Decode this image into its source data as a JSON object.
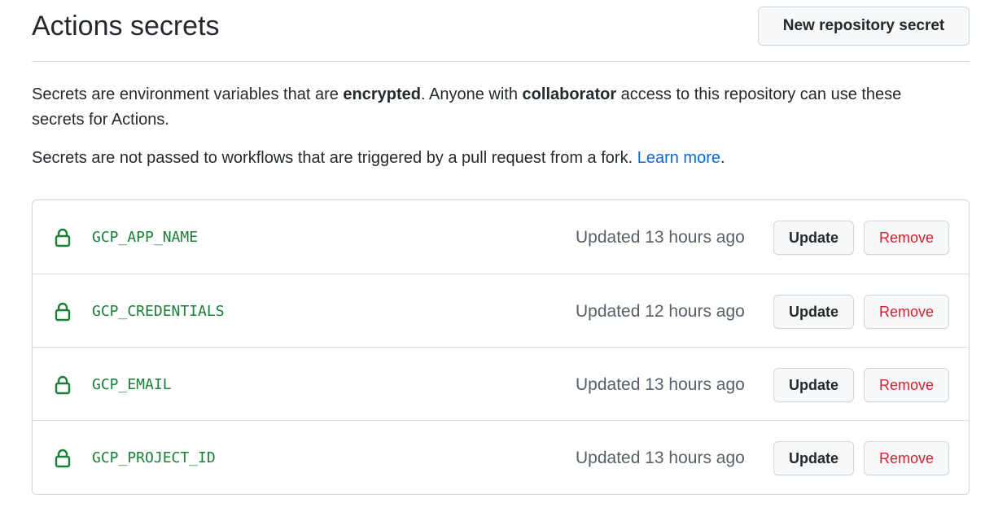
{
  "header": {
    "title": "Actions secrets",
    "new_secret_label": "New repository secret"
  },
  "description": {
    "line1_part1": "Secrets are environment variables that are ",
    "line1_bold1": "encrypted",
    "line1_part2": ". Anyone with ",
    "line1_bold2": "collaborator",
    "line1_part3": " access to this repository can use these secrets for Actions.",
    "line2_text": "Secrets are not passed to workflows that are triggered by a pull request from a fork. ",
    "line2_link": "Learn more",
    "line2_end": "."
  },
  "secrets": [
    {
      "name": "GCP_APP_NAME",
      "updated": "Updated 13 hours ago",
      "update_label": "Update",
      "remove_label": "Remove"
    },
    {
      "name": "GCP_CREDENTIALS",
      "updated": "Updated 12 hours ago",
      "update_label": "Update",
      "remove_label": "Remove"
    },
    {
      "name": "GCP_EMAIL",
      "updated": "Updated 13 hours ago",
      "update_label": "Update",
      "remove_label": "Remove"
    },
    {
      "name": "GCP_PROJECT_ID",
      "updated": "Updated 13 hours ago",
      "update_label": "Update",
      "remove_label": "Remove"
    }
  ],
  "icons": {
    "secret": "lock-icon"
  },
  "colors": {
    "secret_name": "#1a7f37",
    "remove": "#cf222e",
    "link": "#0969da"
  }
}
